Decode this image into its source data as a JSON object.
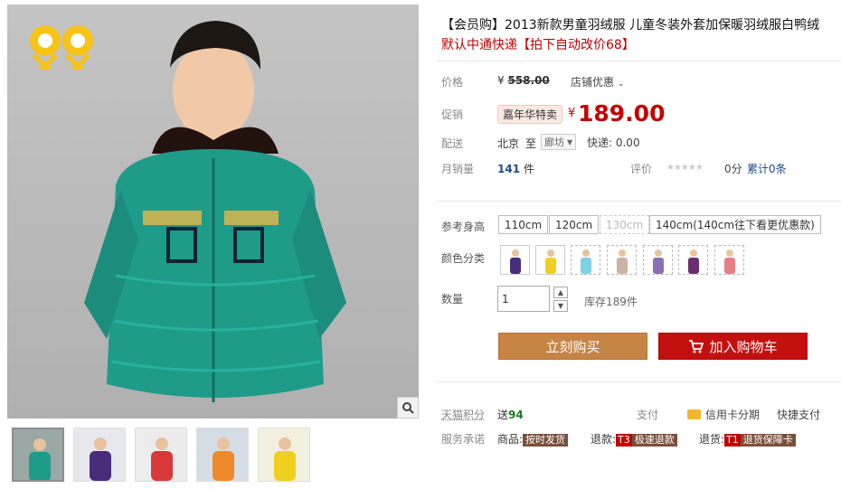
{
  "product": {
    "title": "【会员购】2013新款男童羽绒服 儿童冬装外套加保暖羽绒服白鸭绒",
    "subtitle": "默认中通快递【拍下自动改价68】"
  },
  "price_row": {
    "label": "价格",
    "currency": "¥",
    "original_price": "558.00",
    "shop_promo": "店铺优惠"
  },
  "promo_row": {
    "label": "促销",
    "badge": "嘉年华特卖",
    "currency": "¥",
    "price": "189.00"
  },
  "shipping": {
    "label": "配送",
    "from": "北京",
    "to_word": "至",
    "destination": "廊坊",
    "fee": "快递: 0.00"
  },
  "sales": {
    "label": "月销量",
    "count": "141",
    "unit": "件",
    "rating_label": "评价",
    "stars": "★★★★★",
    "score": "0分",
    "reviews": "累计0条"
  },
  "size": {
    "label": "参考身高",
    "options": [
      "110cm",
      "120cm",
      "130cm",
      "140cm(140cm往下看更优惠款)"
    ]
  },
  "color": {
    "label": "颜色分类"
  },
  "quantity": {
    "label": "数量",
    "value": "1",
    "stock": "库存189件"
  },
  "actions": {
    "buy": "立刻购买",
    "cart": "加入购物车"
  },
  "points": {
    "label": "天猫积分",
    "give": "送",
    "amount": "94",
    "pay_label": "支付",
    "credit": "信用卡分期",
    "quick": "快捷支付"
  },
  "service": {
    "label": "服务承诺",
    "goods_label": "商品:",
    "goods_tag": "按时发货",
    "refund_label": "退款:",
    "refund_code": "T3",
    "refund_tag": "极速退款",
    "return_label": "退货:",
    "return_code": "T1",
    "return_tag": "退货保障卡"
  },
  "colors": {
    "accent_red": "#c40000",
    "buy_orange": "#c68445",
    "cart_red": "#c40f0f",
    "jacket_teal": "#1f9b8a"
  }
}
